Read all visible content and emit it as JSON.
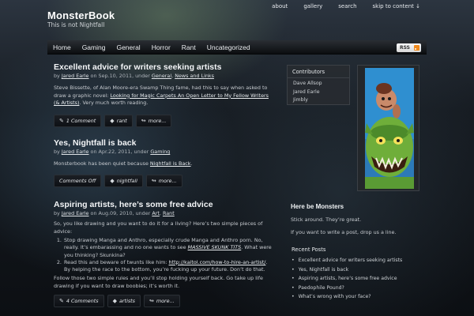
{
  "toplinks": {
    "about": "about",
    "gallery": "gallery",
    "search": "search",
    "skip": "skip to content ↓"
  },
  "header": {
    "title": "MonsterBook",
    "tagline": "This is not Nightfall"
  },
  "nav": {
    "items": [
      "Home",
      "Gaming",
      "General",
      "Horror",
      "Rant",
      "Uncategorized"
    ],
    "rss_label": "RSS"
  },
  "posts": [
    {
      "title": "Excellent advice for writers seeking artists",
      "by": "by",
      "author": "Jared Earle",
      "on": "on Sep.10, 2011, under",
      "cat1": "General",
      "sep": ",",
      "cat2": "News and Links",
      "excerpt_a": "Steve Bissette, of Alan Moore-era Swamp Thing fame, had this to say when asked to draw a graphic novel: ",
      "excerpt_link": "Looking for Magic Carpets An Open Letter to My Fellow Writers (& Artists)",
      "excerpt_b": ". Very much worth reading.",
      "btn_comments": "1 Comment",
      "btn_tag": "rant",
      "btn_more": "more..."
    },
    {
      "title": "Yes, Nightfall is back",
      "by": "by",
      "author": "Jared Earle",
      "on": "on Apr.22, 2011, under",
      "cat1": "Gaming",
      "excerpt_a": "Monsterbook has been quiet because ",
      "excerpt_link": "Nightfall is Back",
      "excerpt_b": ".",
      "btn_comments": "Comments Off",
      "btn_tag": "nightfall",
      "btn_more": "more..."
    },
    {
      "title": "Aspiring artists, here’s some free advice",
      "by": "by",
      "author": "Jared Earle",
      "on": "on Aug.09, 2010, under",
      "cat1": "Art",
      "sep": ",",
      "cat2": "Rant",
      "intro": "So, you like drawing and you want to do it for a living? Here’s two simple pieces of advice:",
      "rule1_a": "Stop drawing Manga and Anthro, especially crude Manga and Anthro porn. No, really. It’s embarassing and no one wants to see ",
      "rule1_link": "MASSIVE SKUNK TITS",
      "rule1_b": ". What were you thinking? Skunkina?",
      "rule2_a": "Read this and beware of twunts like him: ",
      "rule2_link": "http://kaitol.com/how-to-hire-an-artist/",
      "rule2_b": ". By helping the race to the bottom, you’re fucking up your future. Don’t do that.",
      "outro": "Follow those two simple rules and you’ll stop holding yourself back. Go take up life drawing if you want to draw boobies; it’s worth it.",
      "btn_comments": "4 Comments",
      "btn_tag": "artists",
      "btn_more": "more..."
    }
  ],
  "sidebar": {
    "contributors_heading": "Contributors",
    "contributors": [
      "Dave Allsop",
      "Jared Earle",
      "Jimbly"
    ],
    "monsters_heading": "Here be Monsters",
    "monsters_text1": "Stick around. They’re great.",
    "monsters_text2": "If you want to write a post, drop us a line.",
    "recent_heading": "Recent Posts",
    "recent": [
      "Excellent advice for writers seeking artists",
      "Yes, Nightfall is back",
      "Aspiring artists, here’s some free advice",
      "Paedophile Pound?",
      "What’s wrong with your face?"
    ]
  },
  "icons": {
    "comment": "comment-icon",
    "tag": "tag-icon",
    "more": "more-icon",
    "rss": "rss-icon"
  }
}
